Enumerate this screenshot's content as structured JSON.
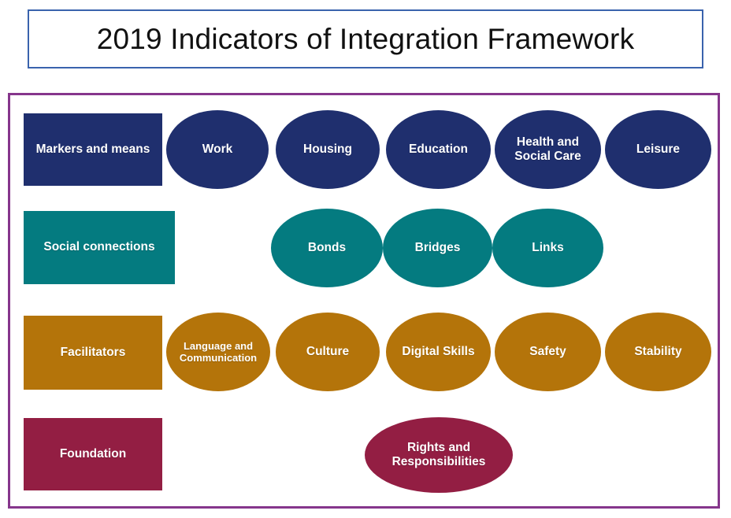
{
  "title": {
    "text": "2019 Indicators of Integration Framework",
    "border_color": "#3A63AD"
  },
  "frame": {
    "border_color": "#86368C"
  },
  "colors": {
    "markers_and_means": "#1F2F6E",
    "social_connections": "#047B80",
    "facilitators": "#B4740A",
    "foundation": "#931E43",
    "label_text": "#FFFFFF"
  },
  "rows": [
    {
      "key": "markers-and-means",
      "category_label": "Markers and means",
      "color": "#1F2F6E",
      "domains": [
        {
          "label": "Work"
        },
        {
          "label": "Housing"
        },
        {
          "label": "Education"
        },
        {
          "label": "Health and Social Care"
        },
        {
          "label": "Leisure"
        }
      ]
    },
    {
      "key": "social-connections",
      "category_label": "Social connections",
      "color": "#047B80",
      "domains": [
        {
          "label": "Bonds"
        },
        {
          "label": "Bridges"
        },
        {
          "label": "Links"
        }
      ]
    },
    {
      "key": "facilitators",
      "category_label": "Facilitators",
      "color": "#B4740A",
      "domains": [
        {
          "label": "Language and Communication"
        },
        {
          "label": "Culture"
        },
        {
          "label": "Digital Skills"
        },
        {
          "label": "Safety"
        },
        {
          "label": "Stability"
        }
      ]
    },
    {
      "key": "foundation",
      "category_label": "Foundation",
      "color": "#931E43",
      "domains": [
        {
          "label": "Rights and Responsibilities"
        }
      ]
    }
  ]
}
